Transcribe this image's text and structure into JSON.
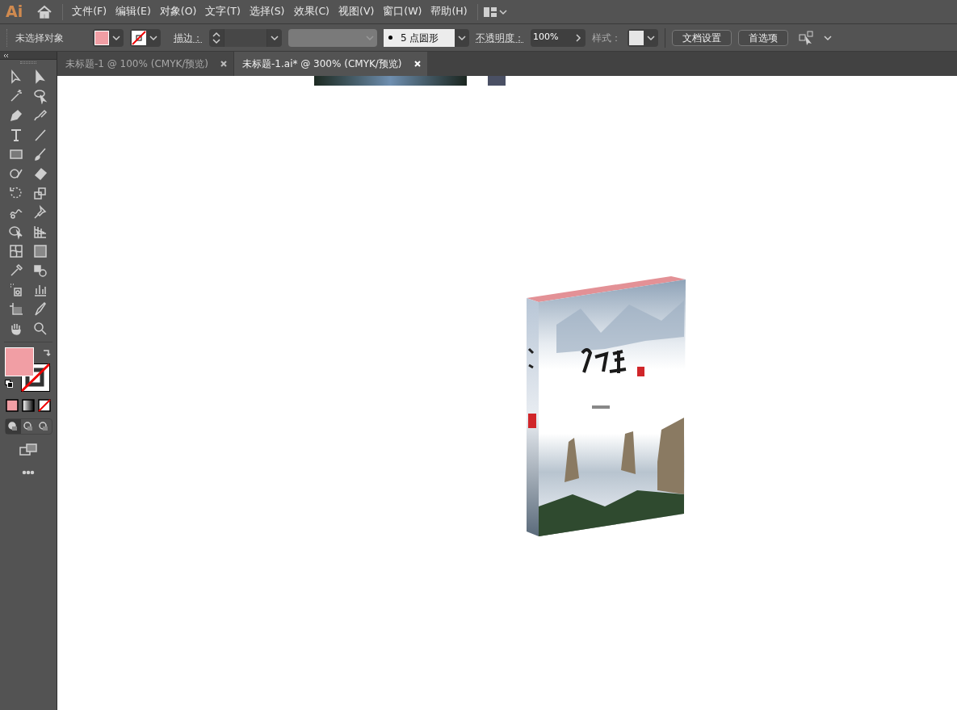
{
  "app": {
    "logo": "Ai"
  },
  "menu": [
    "文件(F)",
    "编辑(E)",
    "对象(O)",
    "文字(T)",
    "选择(S)",
    "效果(C)",
    "视图(V)",
    "窗口(W)",
    "帮助(H)"
  ],
  "control_bar": {
    "selection": "未选择对象",
    "stroke_label": "描边：",
    "brush": "5 点圆形",
    "opacity_label": "不透明度：",
    "opacity": "100%",
    "style_label": "样式：",
    "buttons": [
      "文档设置",
      "首选项"
    ]
  },
  "tabs": [
    {
      "title": "未标题-1 @ 100% (CMYK/预览)",
      "selected": false
    },
    {
      "title": "未标题-1.ai* @ 300% (CMYK/预览)",
      "selected": true
    }
  ]
}
